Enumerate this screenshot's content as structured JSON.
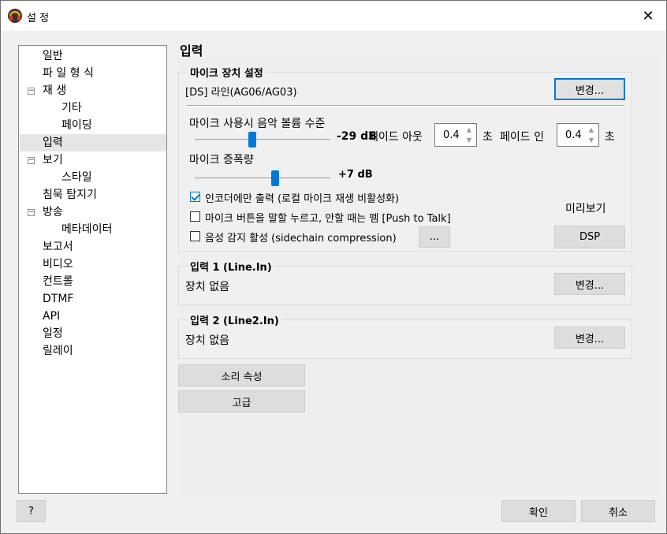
{
  "window": {
    "title": "설 정",
    "close_label": "✕",
    "help_label": "?",
    "ok_label": "확인",
    "cancel_label": "취소"
  },
  "sidebar": {
    "items": [
      {
        "label": "일반",
        "level": 0,
        "expander": ""
      },
      {
        "label": "파 일 형 식",
        "level": 0,
        "expander": ""
      },
      {
        "label": "재 생",
        "level": 0,
        "expander": "⊟"
      },
      {
        "label": "기타",
        "level": 1,
        "expander": ""
      },
      {
        "label": "페이딩",
        "level": 1,
        "expander": ""
      },
      {
        "label": "입력",
        "level": 0,
        "expander": "",
        "selected": true
      },
      {
        "label": "보기",
        "level": 0,
        "expander": "⊟"
      },
      {
        "label": "스타일",
        "level": 1,
        "expander": ""
      },
      {
        "label": "침묵 탐지기",
        "level": 0,
        "expander": ""
      },
      {
        "label": "방송",
        "level": 0,
        "expander": "⊟"
      },
      {
        "label": "메타데이터",
        "level": 1,
        "expander": ""
      },
      {
        "label": "보고서",
        "level": 0,
        "expander": ""
      },
      {
        "label": "비디오",
        "level": 0,
        "expander": ""
      },
      {
        "label": "컨트롤",
        "level": 0,
        "expander": ""
      },
      {
        "label": "DTMF",
        "level": 0,
        "expander": ""
      },
      {
        "label": "API",
        "level": 0,
        "expander": ""
      },
      {
        "label": "일정",
        "level": 0,
        "expander": ""
      },
      {
        "label": "릴레이",
        "level": 0,
        "expander": ""
      }
    ]
  },
  "page": {
    "title": "입력",
    "mic_group": {
      "title": "마이크 장치 설정",
      "device": "[DS] 라인(AG06/AG03)",
      "change_label": "변경...",
      "music_volume_label": "마이크 사용시 음악 볼륨 수준",
      "music_volume_value": "-29 dB",
      "music_volume_level": 0.42,
      "fade_out_label": "페이드 아웃",
      "fade_out_value": "0.4",
      "fade_out_unit": "초",
      "fade_in_label": "페이드 인",
      "fade_in_value": "0.4",
      "fade_in_unit": "초",
      "gain_label": "마이크 증폭량",
      "gain_value": "+7 dB",
      "gain_level": 0.6,
      "encoder_only_label": "인코더에만 출력 (로컬 마이크 재생 비활성화)",
      "encoder_only_checked": true,
      "push_to_talk_label": "마이크 버튼을 말할 누르고, 안할 때는 뗌 [Push to Talk]",
      "push_to_talk_checked": false,
      "sidechain_label": "음성 감지 활성 (sidechain compression)",
      "sidechain_checked": false,
      "sidechain_button": "...",
      "preview_label": "미리보기",
      "dsp_label": "DSP"
    },
    "input1": {
      "title": "입력 1 (Line.In)",
      "device": "장치 없음",
      "change_label": "변경..."
    },
    "input2": {
      "title": "입력 2 (Line2.In)",
      "device": "장치 없음",
      "change_label": "변경..."
    },
    "sound_props_label": "소리 속성",
    "advanced_label": "고급"
  }
}
